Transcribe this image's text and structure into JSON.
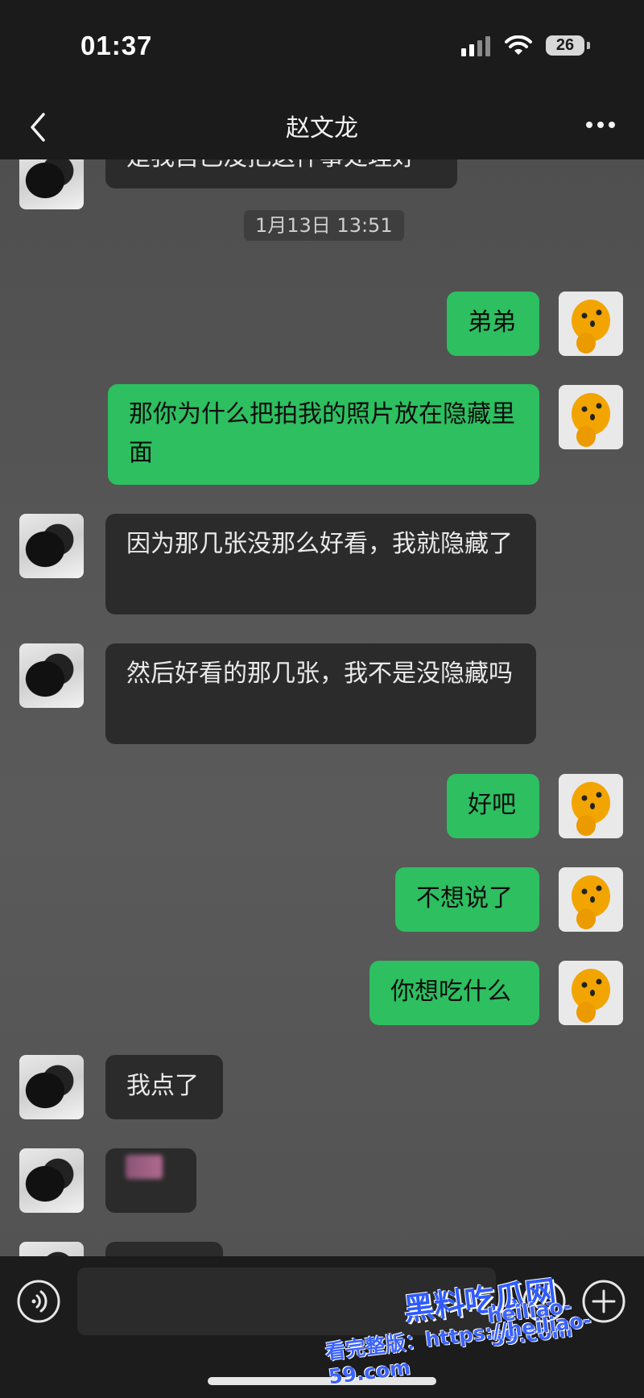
{
  "status_bar": {
    "time": "01:37",
    "battery": "26"
  },
  "header": {
    "title": "赵文龙"
  },
  "chat": {
    "timestamp": "1月13日 13:51",
    "messages": [
      {
        "sender": "peer",
        "text": "是我自己没把这件事处理好"
      },
      {
        "sender": "self",
        "text": "弟弟"
      },
      {
        "sender": "self",
        "text": "那你为什么把拍我的照片放在隐藏里面"
      },
      {
        "sender": "peer",
        "text": "因为那几张没那么好看，我就隐藏了"
      },
      {
        "sender": "peer",
        "text": "然后好看的那几张，我不是没隐藏吗"
      },
      {
        "sender": "self",
        "text": "好吧"
      },
      {
        "sender": "self",
        "text": "不想说了"
      },
      {
        "sender": "self",
        "text": "你想吃什么"
      },
      {
        "sender": "peer",
        "text": "我点了"
      },
      {
        "sender": "peer",
        "text": ""
      }
    ]
  },
  "input_bar": {
    "placeholder": ""
  },
  "watermark": {
    "brand": "黑料吃瓜网",
    "domain": "heiliao-59.com",
    "url_text": "看完整版：https://heiliao-59.com"
  },
  "colors": {
    "self_bubble": "#2dbf60",
    "peer_bubble": "#2b2b2b",
    "bar": "#1b1b1b"
  }
}
